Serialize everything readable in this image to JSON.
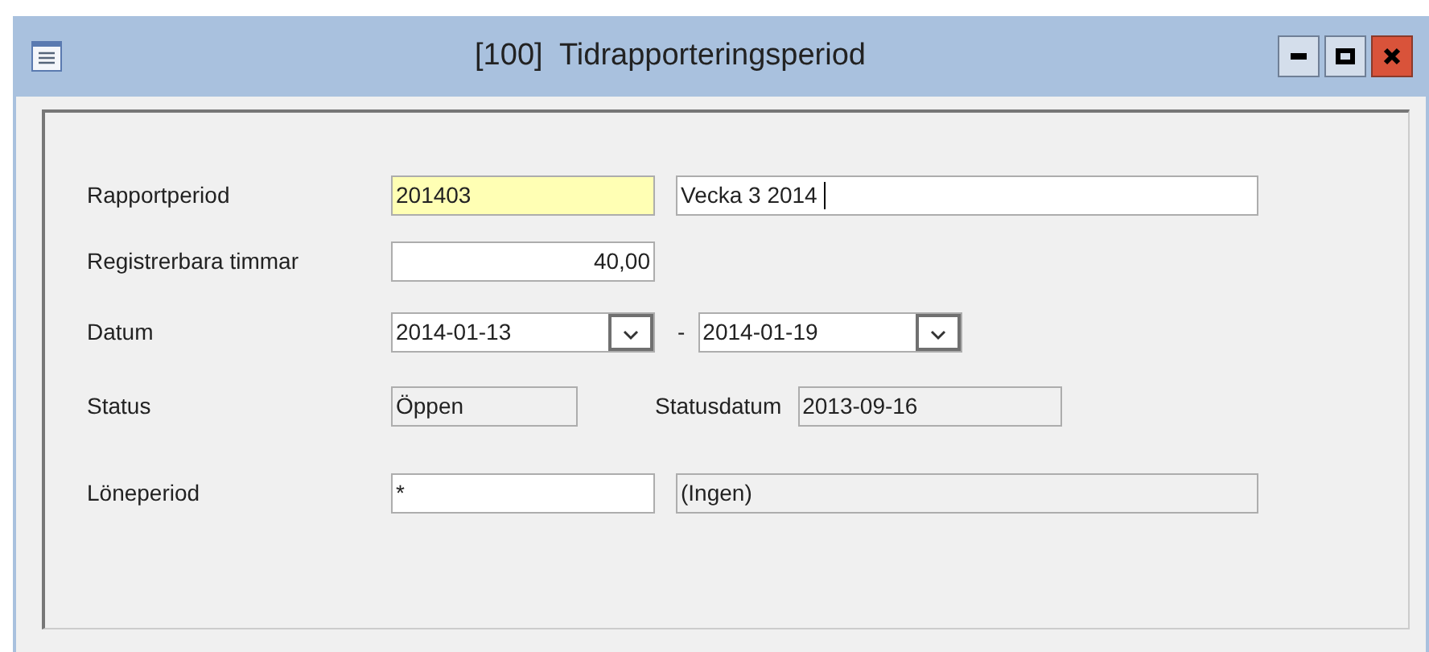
{
  "window": {
    "title": "[100]  Tidrapporteringsperiod"
  },
  "rows": [
    {
      "label": "Rapportperiod",
      "fields": [
        {
          "kind": "input",
          "value": "201403",
          "highlighted": true,
          "caret": false
        },
        {
          "kind": "input",
          "value": "Vecka 3 2014",
          "highlighted": false,
          "caret": true
        }
      ]
    },
    {
      "label": "Registrerbara timmar",
      "fields": [
        {
          "kind": "number",
          "value": "40,00",
          "highlighted": false,
          "caret": false
        }
      ]
    },
    {
      "label": "Datum",
      "fields": [
        {
          "kind": "date",
          "value": "2014-01-13"
        },
        {
          "kind": "separator",
          "text": "-"
        },
        {
          "kind": "date",
          "value": "2014-01-19"
        }
      ]
    },
    {
      "label": "Status",
      "fields": [
        {
          "kind": "readonly",
          "value": "Öppen"
        },
        {
          "kind": "label",
          "text": "Statusdatum"
        },
        {
          "kind": "readonly",
          "value": "2013-09-16"
        }
      ]
    },
    {
      "label": "Löneperiod",
      "fields": [
        {
          "kind": "input",
          "value": "*",
          "highlighted": false,
          "caret": false
        },
        {
          "kind": "readonly",
          "value": "(Ingen)"
        }
      ]
    }
  ]
}
